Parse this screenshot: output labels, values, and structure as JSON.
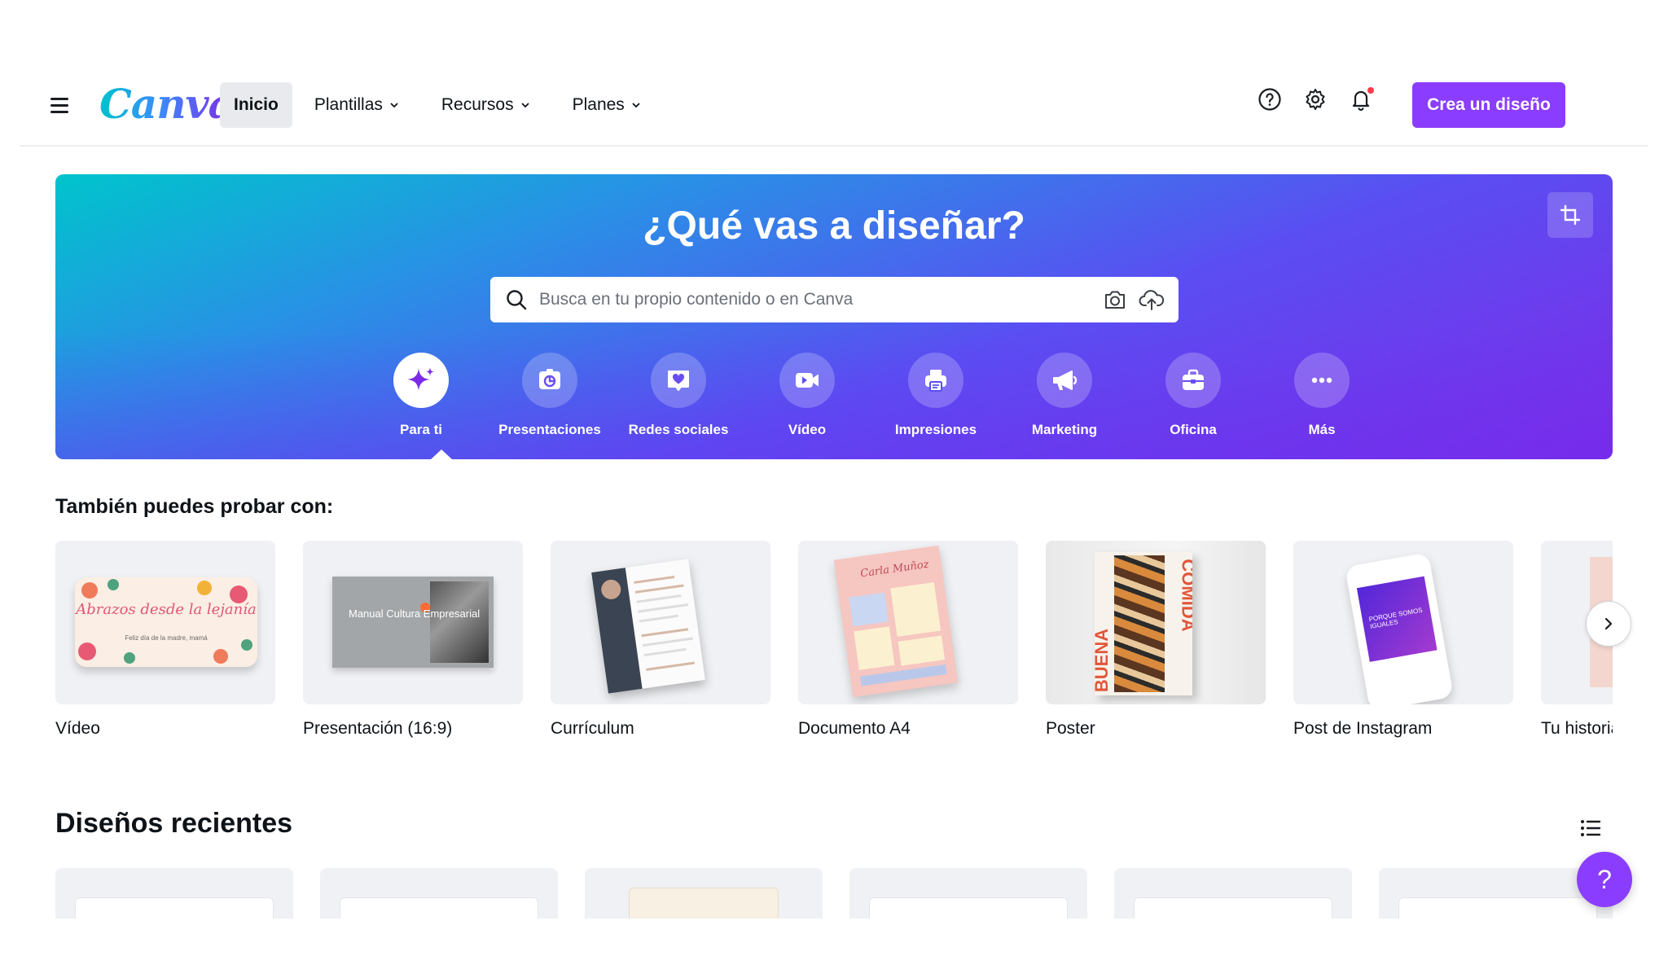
{
  "header": {
    "logo": "Canva",
    "nav": [
      {
        "label": "Inicio",
        "active": true
      },
      {
        "label": "Plantillas"
      },
      {
        "label": "Recursos"
      },
      {
        "label": "Planes"
      }
    ],
    "icons": [
      "help-icon",
      "gear-icon",
      "bell-icon"
    ],
    "create_label": "Crea un diseño",
    "brand_color": "#8b3dff"
  },
  "hero": {
    "title": "¿Qué vas a diseñar?",
    "search_placeholder": "Busca en tu propio contenido o en Canva",
    "categories": [
      {
        "label": "Para ti",
        "icon": "sparkles-icon",
        "active": true
      },
      {
        "label": "Presentaciones",
        "icon": "presentation-icon"
      },
      {
        "label": "Redes sociales",
        "icon": "heart-chat-icon"
      },
      {
        "label": "Vídeo",
        "icon": "video-camera-icon"
      },
      {
        "label": "Impresiones",
        "icon": "printer-icon"
      },
      {
        "label": "Marketing",
        "icon": "megaphone-icon"
      },
      {
        "label": "Oficina",
        "icon": "briefcase-icon"
      },
      {
        "label": "Más",
        "icon": "more-dots-icon"
      }
    ]
  },
  "try_section": {
    "title": "También puedes probar con:",
    "items": [
      {
        "label": "Vídeo",
        "art_text": "Abrazos desde la lejanía",
        "art_subtext": "Feliz día de la madre, mamá"
      },
      {
        "label": "Presentación (16:9)",
        "art_text": "Manual Cultura Empresarial"
      },
      {
        "label": "Currículum"
      },
      {
        "label": "Documento A4",
        "art_text": "Carla Muñoz"
      },
      {
        "label": "Poster",
        "art_text": "BUENA",
        "art_text2": "COMIDA"
      },
      {
        "label": "Post de Instagram",
        "art_text": "PORQUE SOMOS IGUALES"
      },
      {
        "label": "Tu historia"
      }
    ]
  },
  "recent": {
    "title": "Diseños recientes"
  },
  "help_fab": "?"
}
